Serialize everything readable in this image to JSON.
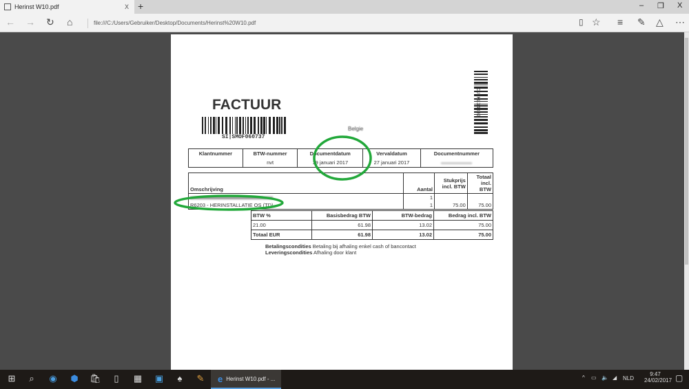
{
  "browser": {
    "tab_title": "Herinst W10.pdf",
    "tab_close": "X",
    "new_tab": "+",
    "minimize": "–",
    "restore": "❐",
    "close": "X",
    "url": "file:///C:/Users/Gebruiker/Desktop/Documents/Herinst%20W10.pdf"
  },
  "invoice": {
    "title": "FACTUUR",
    "barcode_text": "SI|SMOF060737",
    "side_barcode_text": "CU|KL34392",
    "country": "Belgie",
    "header": {
      "labels": [
        "Klantnummer",
        "BTW-nummer",
        "Documentdatum",
        "Vervaldatum",
        "Documentnummer"
      ],
      "values": [
        "",
        "nvt",
        "19 januari 2017",
        "27 januari 2017",
        ""
      ]
    },
    "items": {
      "headers": [
        "Omschrijving",
        "Aantal",
        "Stukprijs incl. BTW",
        "Totaal incl. BTW"
      ],
      "rows": [
        {
          "desc": "",
          "qty": "1",
          "price": "",
          "total": ""
        },
        {
          "desc": "R6203 - HERINSTALLATIE OS (TD)",
          "qty": "1",
          "price": "75.00",
          "total": "75.00"
        }
      ]
    },
    "vat": {
      "headers": [
        "BTW %",
        "Basisbedrag BTW",
        "BTW-bedrag",
        "Bedrag incl. BTW"
      ],
      "row": [
        "21.00",
        "61.98",
        "13.02",
        "75.00"
      ],
      "total": [
        "Totaal EUR",
        "61.98",
        "13.02",
        "75.00"
      ]
    },
    "conditions": [
      {
        "label": "Betalingscondities",
        "value": "Betaling bij afhaling enkel cash of bancontact"
      },
      {
        "label": "Leveringscondities",
        "value": "Afhaling door klant"
      }
    ]
  },
  "taskbar": {
    "active_app": "Herinst W10.pdf - ...",
    "language": "NLD",
    "time": "9:47",
    "date": "24/02/2017"
  },
  "colors": {
    "annotation": "#22a83a"
  }
}
